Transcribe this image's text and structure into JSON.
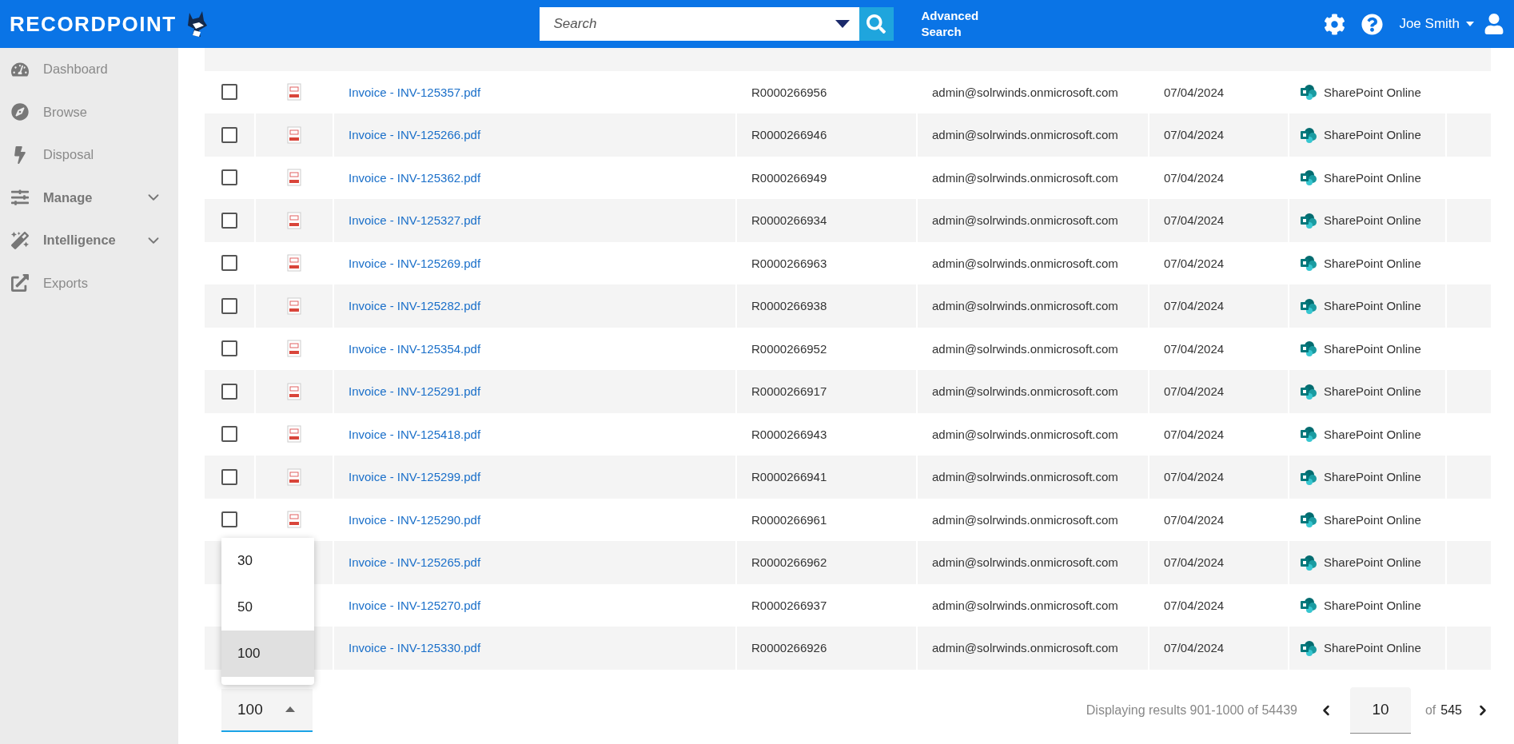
{
  "header": {
    "logo": "RECORDPOINT",
    "search": {
      "placeholder": "Search"
    },
    "advanced_search": "Advanced Search",
    "user": "Joe Smith"
  },
  "sidebar": {
    "items": [
      {
        "label": "Dashboard",
        "kind": "dashboard",
        "bold": false,
        "expandable": false
      },
      {
        "label": "Browse",
        "kind": "browse",
        "bold": false,
        "expandable": false
      },
      {
        "label": "Disposal",
        "kind": "disposal",
        "bold": false,
        "expandable": false
      },
      {
        "label": "Manage",
        "kind": "manage",
        "bold": true,
        "expandable": true
      },
      {
        "label": "Intelligence",
        "kind": "intelligence",
        "bold": true,
        "expandable": true
      },
      {
        "label": "Exports",
        "kind": "exports",
        "bold": false,
        "expandable": false
      }
    ]
  },
  "table": {
    "rows": [
      {
        "checked": false,
        "name": "Invoice - INV-125357.pdf",
        "record_id": "R0000266956",
        "author": "admin@solrwinds.onmicrosoft.com",
        "date": "07/04/2024",
        "source": "SharePoint Online"
      },
      {
        "checked": false,
        "name": "Invoice - INV-125266.pdf",
        "record_id": "R0000266946",
        "author": "admin@solrwinds.onmicrosoft.com",
        "date": "07/04/2024",
        "source": "SharePoint Online"
      },
      {
        "checked": false,
        "name": "Invoice - INV-125362.pdf",
        "record_id": "R0000266949",
        "author": "admin@solrwinds.onmicrosoft.com",
        "date": "07/04/2024",
        "source": "SharePoint Online"
      },
      {
        "checked": false,
        "name": "Invoice - INV-125327.pdf",
        "record_id": "R0000266934",
        "author": "admin@solrwinds.onmicrosoft.com",
        "date": "07/04/2024",
        "source": "SharePoint Online"
      },
      {
        "checked": false,
        "name": "Invoice - INV-125269.pdf",
        "record_id": "R0000266963",
        "author": "admin@solrwinds.onmicrosoft.com",
        "date": "07/04/2024",
        "source": "SharePoint Online"
      },
      {
        "checked": false,
        "name": "Invoice - INV-125282.pdf",
        "record_id": "R0000266938",
        "author": "admin@solrwinds.onmicrosoft.com",
        "date": "07/04/2024",
        "source": "SharePoint Online"
      },
      {
        "checked": false,
        "name": "Invoice - INV-125354.pdf",
        "record_id": "R0000266952",
        "author": "admin@solrwinds.onmicrosoft.com",
        "date": "07/04/2024",
        "source": "SharePoint Online"
      },
      {
        "checked": false,
        "name": "Invoice - INV-125291.pdf",
        "record_id": "R0000266917",
        "author": "admin@solrwinds.onmicrosoft.com",
        "date": "07/04/2024",
        "source": "SharePoint Online"
      },
      {
        "checked": false,
        "name": "Invoice - INV-125418.pdf",
        "record_id": "R0000266943",
        "author": "admin@solrwinds.onmicrosoft.com",
        "date": "07/04/2024",
        "source": "SharePoint Online"
      },
      {
        "checked": false,
        "name": "Invoice - INV-125299.pdf",
        "record_id": "R0000266941",
        "author": "admin@solrwinds.onmicrosoft.com",
        "date": "07/04/2024",
        "source": "SharePoint Online"
      },
      {
        "checked": false,
        "name": "Invoice - INV-125290.pdf",
        "record_id": "R0000266961",
        "author": "admin@solrwinds.onmicrosoft.com",
        "date": "07/04/2024",
        "source": "SharePoint Online"
      },
      {
        "name": "Invoice - INV-125265.pdf",
        "record_id": "R0000266962",
        "author": "admin@solrwinds.onmicrosoft.com",
        "date": "07/04/2024",
        "source": "SharePoint Online"
      },
      {
        "name": "Invoice - INV-125270.pdf",
        "record_id": "R0000266937",
        "author": "admin@solrwinds.onmicrosoft.com",
        "date": "07/04/2024",
        "source": "SharePoint Online"
      },
      {
        "name": "Invoice - INV-125330.pdf",
        "record_id": "R0000266926",
        "author": "admin@solrwinds.onmicrosoft.com",
        "date": "07/04/2024",
        "source": "SharePoint Online"
      }
    ]
  },
  "footer": {
    "page_size": {
      "value": "100",
      "expanded": true,
      "options": [
        {
          "label": "30",
          "selected": false
        },
        {
          "label": "50",
          "selected": false
        },
        {
          "label": "100",
          "selected": true
        }
      ]
    },
    "results": "Displaying results 901-1000 of 54439",
    "page": "10",
    "of": "of",
    "total_pages": "545"
  }
}
